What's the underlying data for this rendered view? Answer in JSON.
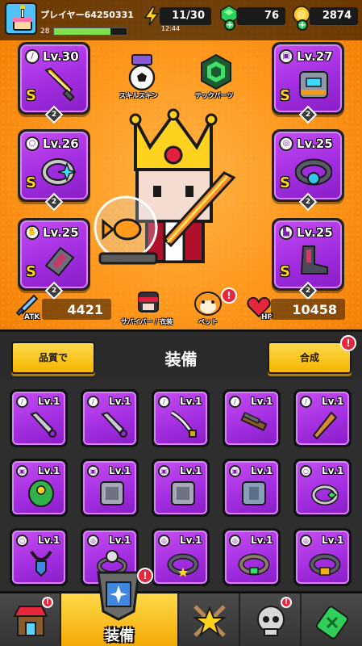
{
  "player": {
    "name": "プレイヤー64250331",
    "level": "28",
    "xp_fraction": 0.78
  },
  "resources": {
    "energy": "11/30",
    "energy_timer": "12:44",
    "gems": "76",
    "coins": "2874"
  },
  "center": {
    "skill_skin_label": "スキルスキン",
    "tech_parts_label": "テックパーツ",
    "survivor_label": "サバイバー / 衣装",
    "pet_label": "ペット"
  },
  "equipped": {
    "left": [
      {
        "slot": "weapon",
        "level": "Lv.30",
        "grade": "S",
        "stars": "2",
        "icon": "sword-icon"
      },
      {
        "slot": "necklace",
        "level": "Lv.26",
        "grade": "S",
        "stars": "2",
        "icon": "ring-icon"
      },
      {
        "slot": "gloves",
        "level": "Lv.25",
        "grade": "S",
        "stars": "2",
        "icon": "gauntlet-icon"
      }
    ],
    "right": [
      {
        "slot": "armor",
        "level": "Lv.27",
        "grade": "S",
        "stars": "2",
        "icon": "armor-icon"
      },
      {
        "slot": "belt",
        "level": "Lv.25",
        "grade": "S",
        "stars": "2",
        "icon": "belt-icon"
      },
      {
        "slot": "boots",
        "level": "Lv.25",
        "grade": "S",
        "stars": "2",
        "icon": "boots-icon"
      }
    ]
  },
  "stats": {
    "atk_label": "ATK",
    "atk": "4421",
    "hp_label": "HP",
    "hp": "10458"
  },
  "inventory_header": {
    "sort_label": "品質で",
    "title": "装備",
    "merge_label": "合成"
  },
  "inventory": [
    {
      "level": "Lv.1",
      "icon": "kunai-icon",
      "kind": "weapon"
    },
    {
      "level": "Lv.1",
      "icon": "kunai-icon",
      "kind": "weapon"
    },
    {
      "level": "Lv.1",
      "icon": "katana-icon",
      "kind": "weapon"
    },
    {
      "level": "Lv.1",
      "icon": "shotgun-icon",
      "kind": "weapon"
    },
    {
      "level": "Lv.1",
      "icon": "bat-icon",
      "kind": "weapon"
    },
    {
      "level": "Lv.1",
      "icon": "leaf-armor-icon",
      "kind": "armor"
    },
    {
      "level": "Lv.1",
      "icon": "plate-armor-icon",
      "kind": "armor"
    },
    {
      "level": "Lv.1",
      "icon": "plate-armor-icon",
      "kind": "armor"
    },
    {
      "level": "Lv.1",
      "icon": "vest-armor-icon",
      "kind": "armor"
    },
    {
      "level": "Lv.1",
      "icon": "emerald-ring-icon",
      "kind": "necklace"
    },
    {
      "level": "Lv.1",
      "icon": "shield-necklace-icon",
      "kind": "necklace"
    },
    {
      "level": "Lv.1",
      "icon": "skull-belt-icon",
      "kind": "belt"
    },
    {
      "level": "Lv.1",
      "icon": "star-belt-icon",
      "kind": "belt"
    },
    {
      "level": "Lv.1",
      "icon": "gem-belt-icon",
      "kind": "belt"
    },
    {
      "level": "Lv.1",
      "icon": "gold-belt-icon",
      "kind": "belt"
    }
  ],
  "nav": {
    "shop": "shop-icon",
    "equipment_label": "装備",
    "battle": "swords-star-icon",
    "evolve": "skull-icon",
    "lab": "battery-icon"
  },
  "colors": {
    "epic_purple": "#a12de0",
    "hero_orange": "#ff9a1f",
    "button_yellow": "#f5b400",
    "alert_red": "#e8263b"
  }
}
